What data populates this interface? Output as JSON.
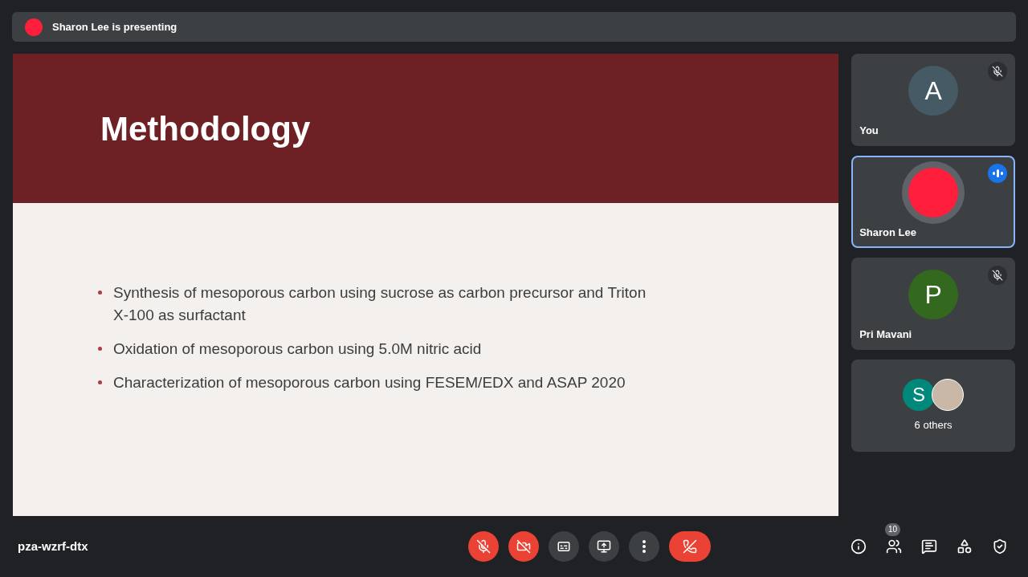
{
  "banner": {
    "text": "Sharon Lee is presenting",
    "color": "#ff1f3d"
  },
  "slide": {
    "title": "Methodology",
    "bullets": [
      "Synthesis of mesoporous carbon using sucrose as carbon precursor and Triton X-100 as surfactant",
      "Oxidation of mesoporous carbon using 5.0M nitric acid",
      "Characterization of mesoporous carbon using FESEM/EDX and ASAP 2020"
    ]
  },
  "participants": [
    {
      "kind": "letter",
      "initial": "A",
      "name": "You",
      "color": "#455a64",
      "muted": true,
      "speaking": false
    },
    {
      "kind": "dot",
      "name": "Sharon Lee",
      "color": "#ff1f3d",
      "speaking": true
    },
    {
      "kind": "letter",
      "initial": "P",
      "name": "Pri Mavani",
      "color": "#33691e",
      "muted": true,
      "speaking": false
    },
    {
      "kind": "group",
      "avatars": [
        {
          "kind": "letter",
          "initial": "S",
          "color": "#00897b"
        },
        {
          "kind": "photo",
          "color": "#c9b8a8"
        }
      ],
      "label": "6 others"
    }
  ],
  "meeting_code": "pza-wzrf-dtx",
  "controls": [
    {
      "kind": "mic",
      "on": false
    },
    {
      "kind": "camera",
      "on": false
    },
    {
      "kind": "captions"
    },
    {
      "kind": "present"
    },
    {
      "kind": "more"
    },
    {
      "kind": "leave"
    }
  ],
  "side_icons": [
    {
      "kind": "info"
    },
    {
      "kind": "people",
      "badge": "10"
    },
    {
      "kind": "chat"
    },
    {
      "kind": "activities"
    },
    {
      "kind": "safety"
    }
  ]
}
